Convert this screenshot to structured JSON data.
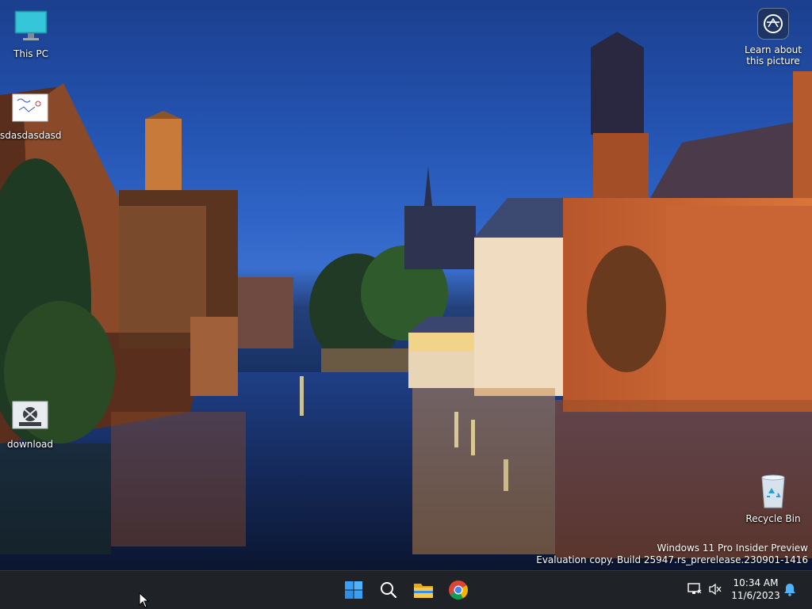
{
  "desktop": {
    "icons": [
      {
        "label": "This PC",
        "icon": "this-pc-icon"
      },
      {
        "label": "sdasdasdasd",
        "icon": "image-file-icon"
      },
      {
        "label": "download",
        "icon": "image-file-icon"
      },
      {
        "label": "Recycle Bin",
        "icon": "recycle-bin-icon"
      }
    ],
    "learn_about_picture": {
      "line1": "Learn about",
      "line2": "this picture",
      "icon": "camera-lens-icon"
    },
    "watermark": {
      "line1": "Windows 11 Pro Insider Preview",
      "line2": "Evaluation copy. Build 25947.rs_prerelease.230901-1416"
    }
  },
  "taskbar": {
    "apps": [
      {
        "name": "Start",
        "icon": "windows-start-icon"
      },
      {
        "name": "Search",
        "icon": "search-icon"
      },
      {
        "name": "File Explorer",
        "icon": "folder-icon"
      },
      {
        "name": "Google Chrome",
        "icon": "chrome-icon"
      }
    ],
    "tray": {
      "network_icon": "network-icon",
      "volume_icon": "volume-muted-icon",
      "time": "10:34 AM",
      "date": "11/6/2023",
      "notification_icon": "bell-icon"
    }
  },
  "colors": {
    "taskbar_bg": "#1f2226",
    "sky": "#2f64c6",
    "start_blue": "#3aa0f5"
  }
}
